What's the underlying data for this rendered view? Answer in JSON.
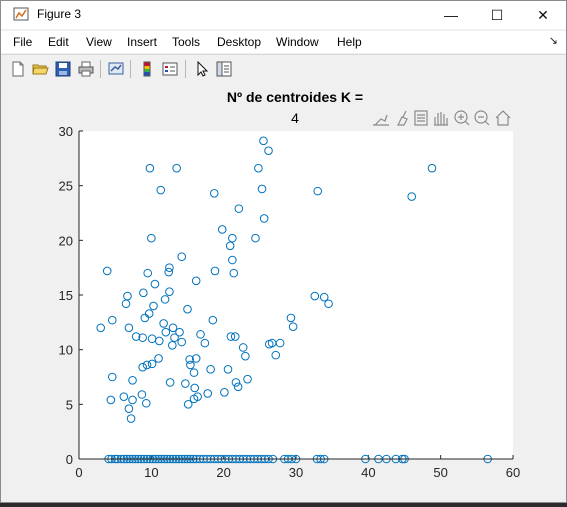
{
  "window": {
    "title": "Figure 3",
    "controls": {
      "minimize": "—",
      "maximize": "☐",
      "close": "✕"
    }
  },
  "menu": {
    "items": [
      "File",
      "Edit",
      "View",
      "Insert",
      "Tools",
      "Desktop",
      "Window",
      "Help"
    ],
    "dock_glyph": "↘"
  },
  "toolbar": {
    "icons": [
      "new-figure-icon",
      "open-file-icon",
      "save-icon",
      "print-icon",
      "link-plot-icon",
      "insert-colorbar-icon",
      "insert-legend-icon",
      "pointer-icon",
      "property-inspector-icon"
    ]
  },
  "axes_toolbar": {
    "icons": [
      "export-icon",
      "brush-icon",
      "data-tips-icon",
      "pan-hand-icon",
      "zoom-in-icon",
      "zoom-out-icon",
      "home-restore-icon"
    ]
  },
  "chart_data": {
    "type": "scatter",
    "title": "Nº de centroides K =",
    "subtitle": "4",
    "xlabel": "",
    "ylabel": "",
    "xlim": [
      0,
      60
    ],
    "ylim": [
      0,
      30
    ],
    "xticks": [
      0,
      10,
      20,
      30,
      40,
      50,
      60
    ],
    "yticks": [
      0,
      5,
      10,
      15,
      20,
      25,
      30
    ],
    "grid": false,
    "marker": "circle-open",
    "color": "#0072bd",
    "points": [
      [
        3.9,
        17.2
      ],
      [
        3.0,
        12.0
      ],
      [
        4.6,
        12.7
      ],
      [
        4.4,
        5.4
      ],
      [
        4.6,
        7.5
      ],
      [
        6.2,
        5.7
      ],
      [
        6.5,
        14.2
      ],
      [
        6.7,
        14.9
      ],
      [
        6.9,
        12.0
      ],
      [
        6.9,
        4.6
      ],
      [
        7.2,
        3.7
      ],
      [
        7.4,
        5.4
      ],
      [
        7.4,
        7.2
      ],
      [
        7.9,
        11.2
      ],
      [
        8.7,
        5.9
      ],
      [
        8.8,
        8.4
      ],
      [
        8.8,
        11.1
      ],
      [
        8.9,
        15.2
      ],
      [
        9.1,
        12.9
      ],
      [
        9.3,
        5.1
      ],
      [
        9.4,
        8.6
      ],
      [
        9.5,
        17.0
      ],
      [
        9.7,
        13.3
      ],
      [
        9.8,
        26.6
      ],
      [
        10.0,
        20.2
      ],
      [
        10.1,
        8.7
      ],
      [
        10.1,
        11.0
      ],
      [
        10.3,
        14.0
      ],
      [
        10.5,
        16.0
      ],
      [
        11.0,
        9.2
      ],
      [
        11.1,
        10.8
      ],
      [
        11.3,
        24.6
      ],
      [
        11.7,
        12.4
      ],
      [
        11.9,
        14.6
      ],
      [
        12.0,
        11.6
      ],
      [
        12.4,
        17.1
      ],
      [
        12.5,
        17.5
      ],
      [
        12.5,
        15.3
      ],
      [
        12.6,
        7.0
      ],
      [
        12.9,
        10.4
      ],
      [
        13.0,
        12.0
      ],
      [
        13.2,
        11.1
      ],
      [
        13.5,
        26.6
      ],
      [
        13.9,
        11.6
      ],
      [
        14.2,
        18.5
      ],
      [
        14.7,
        6.9
      ],
      [
        15.0,
        13.7
      ],
      [
        15.1,
        5.0
      ],
      [
        15.3,
        9.1
      ],
      [
        15.4,
        8.6
      ],
      [
        15.9,
        5.5
      ],
      [
        15.9,
        7.9
      ],
      [
        16.0,
        6.5
      ],
      [
        16.2,
        9.2
      ],
      [
        16.2,
        16.3
      ],
      [
        16.4,
        5.7
      ],
      [
        16.8,
        11.4
      ],
      [
        17.4,
        10.6
      ],
      [
        17.8,
        6.0
      ],
      [
        18.2,
        8.2
      ],
      [
        18.5,
        12.7
      ],
      [
        18.7,
        24.3
      ],
      [
        18.8,
        17.2
      ],
      [
        19.8,
        21.0
      ],
      [
        20.1,
        6.1
      ],
      [
        20.9,
        19.5
      ],
      [
        21.0,
        11.2
      ],
      [
        21.2,
        18.2
      ],
      [
        21.2,
        20.2
      ],
      [
        21.4,
        17.0
      ],
      [
        21.6,
        11.2
      ],
      [
        21.7,
        7.0
      ],
      [
        22.0,
        6.6
      ],
      [
        22.1,
        22.9
      ],
      [
        22.7,
        10.2
      ],
      [
        23.0,
        9.4
      ],
      [
        23.3,
        7.3
      ],
      [
        24.4,
        20.2
      ],
      [
        24.8,
        26.6
      ],
      [
        25.3,
        24.7
      ],
      [
        25.5,
        29.1
      ],
      [
        25.6,
        22.0
      ],
      [
        26.2,
        28.2
      ],
      [
        26.3,
        10.5
      ],
      [
        26.7,
        10.6
      ],
      [
        27.2,
        9.5
      ],
      [
        27.8,
        10.6
      ],
      [
        29.3,
        12.9
      ],
      [
        29.6,
        12.1
      ],
      [
        32.6,
        14.9
      ],
      [
        33.0,
        24.5
      ],
      [
        33.9,
        14.8
      ],
      [
        34.5,
        14.2
      ],
      [
        46.0,
        24.0
      ],
      [
        48.8,
        26.6
      ],
      [
        14.2,
        10.7
      ],
      [
        20.6,
        8.2
      ],
      [
        4.1,
        0
      ],
      [
        4.5,
        0
      ],
      [
        5.0,
        0
      ],
      [
        5.3,
        0
      ],
      [
        5.8,
        0
      ],
      [
        6.2,
        0
      ],
      [
        6.6,
        0
      ],
      [
        7.0,
        0
      ],
      [
        7.4,
        0
      ],
      [
        7.8,
        0
      ],
      [
        8.2,
        0
      ],
      [
        8.6,
        0
      ],
      [
        9.0,
        0
      ],
      [
        9.4,
        0
      ],
      [
        9.8,
        0
      ],
      [
        10.2,
        0
      ],
      [
        10.6,
        0
      ],
      [
        11.0,
        0
      ],
      [
        11.4,
        0
      ],
      [
        11.8,
        0
      ],
      [
        12.2,
        0
      ],
      [
        12.6,
        0
      ],
      [
        13.0,
        0
      ],
      [
        13.4,
        0
      ],
      [
        13.8,
        0
      ],
      [
        14.2,
        0
      ],
      [
        14.6,
        0
      ],
      [
        15.0,
        0
      ],
      [
        15.4,
        0
      ],
      [
        15.8,
        0
      ],
      [
        16.2,
        0
      ],
      [
        16.7,
        0
      ],
      [
        17.2,
        0
      ],
      [
        17.7,
        0
      ],
      [
        18.2,
        0
      ],
      [
        18.7,
        0
      ],
      [
        19.2,
        0
      ],
      [
        19.7,
        0
      ],
      [
        20.2,
        0
      ],
      [
        20.7,
        0
      ],
      [
        21.2,
        0
      ],
      [
        21.7,
        0
      ],
      [
        22.2,
        0
      ],
      [
        22.7,
        0
      ],
      [
        23.2,
        0
      ],
      [
        23.7,
        0
      ],
      [
        24.2,
        0
      ],
      [
        24.7,
        0
      ],
      [
        25.2,
        0
      ],
      [
        25.7,
        0
      ],
      [
        26.2,
        0
      ],
      [
        26.8,
        0
      ],
      [
        28.4,
        0
      ],
      [
        28.9,
        0
      ],
      [
        29.4,
        0
      ],
      [
        30.0,
        0
      ],
      [
        32.9,
        0
      ],
      [
        33.4,
        0
      ],
      [
        33.9,
        0
      ],
      [
        39.6,
        0
      ],
      [
        41.4,
        0
      ],
      [
        42.5,
        0
      ],
      [
        43.8,
        0
      ],
      [
        44.7,
        0
      ],
      [
        45.0,
        0
      ],
      [
        56.5,
        0
      ]
    ]
  }
}
